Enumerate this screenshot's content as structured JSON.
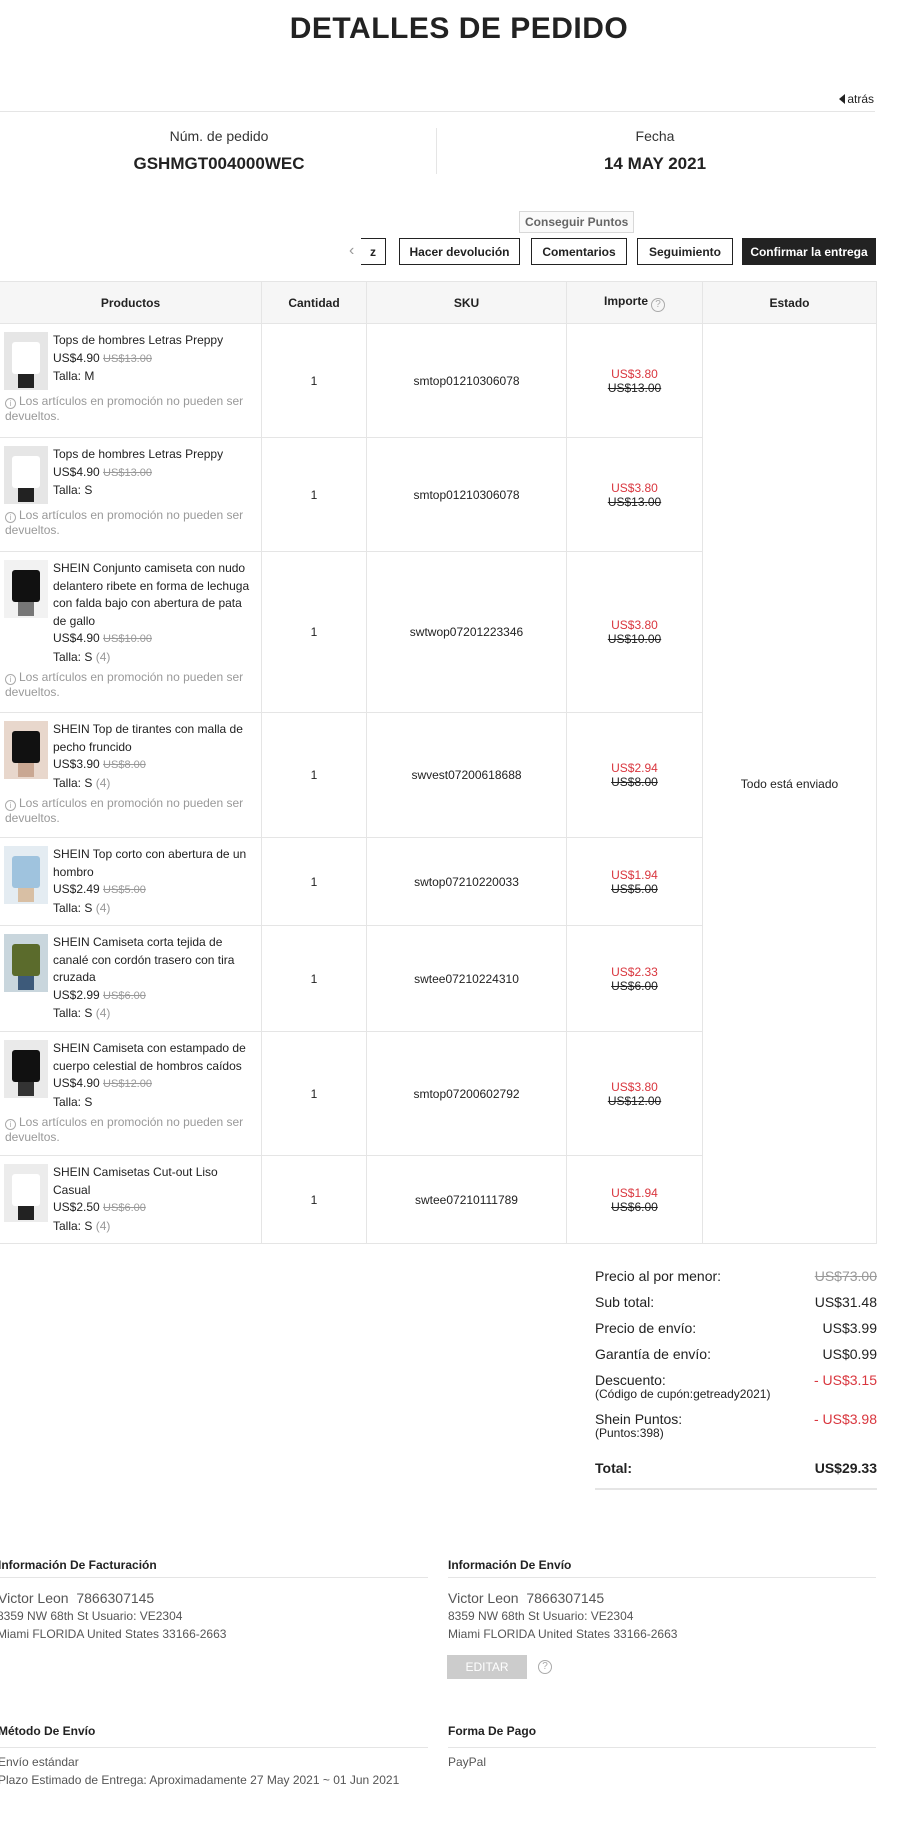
{
  "page": {
    "title": "DETALLES DE PEDIDO",
    "back_label": "atrás"
  },
  "order": {
    "number_label": "Núm. de pedido",
    "number": "GSHMGT004000WEC",
    "date_label": "Fecha",
    "date": "14 MAY 2021"
  },
  "tooltip": "Conseguir Puntos",
  "actions": {
    "partial": "z",
    "return": "Hacer devolución",
    "reviews": "Comentarios",
    "track": "Seguimiento",
    "confirm": "Confirmar la entrega"
  },
  "table": {
    "headers": {
      "products": "Productos",
      "qty": "Cantidad",
      "sku": "SKU",
      "amount": "Importe",
      "status": "Estado"
    },
    "status_text": "Todo está enviado",
    "promo_note": "Los artículos en promoción no pueden ser devueltos.",
    "rows": [
      {
        "name": "Tops de hombres Letras Preppy",
        "price": "US$4.90",
        "orig": "US$13.00",
        "size": "Talla: M",
        "size_qty": "",
        "qty": "1",
        "sku": "smtop01210306078",
        "amount": "US$3.80",
        "amount_orig": "US$13.00",
        "note": true
      },
      {
        "name": "Tops de hombres Letras Preppy",
        "price": "US$4.90",
        "orig": "US$13.00",
        "size": "Talla: S",
        "size_qty": "",
        "qty": "1",
        "sku": "smtop01210306078",
        "amount": "US$3.80",
        "amount_orig": "US$13.00",
        "note": true
      },
      {
        "name": "SHEIN Conjunto camiseta con nudo delantero ribete en forma de lechuga con falda bajo con abertura de pata de gallo",
        "price": "US$4.90",
        "orig": "US$10.00",
        "size": "Talla: S",
        "size_qty": "(4)",
        "qty": "1",
        "sku": "swtwop07201223346",
        "amount": "US$3.80",
        "amount_orig": "US$10.00",
        "note": true
      },
      {
        "name": "SHEIN Top de tirantes con malla de pecho fruncido",
        "price": "US$3.90",
        "orig": "US$8.00",
        "size": "Talla: S",
        "size_qty": "(4)",
        "qty": "1",
        "sku": "swvest07200618688",
        "amount": "US$2.94",
        "amount_orig": "US$8.00",
        "note": true
      },
      {
        "name": "SHEIN Top corto con abertura de un hombro",
        "price": "US$2.49",
        "orig": "US$5.00",
        "size": "Talla: S",
        "size_qty": "(4)",
        "qty": "1",
        "sku": "swtop07210220033",
        "amount": "US$1.94",
        "amount_orig": "US$5.00",
        "note": false
      },
      {
        "name": "SHEIN Camiseta corta tejida de canalé con cordón trasero con tira cruzada",
        "price": "US$2.99",
        "orig": "US$6.00",
        "size": "Talla: S",
        "size_qty": "(4)",
        "qty": "1",
        "sku": "swtee07210224310",
        "amount": "US$2.33",
        "amount_orig": "US$6.00",
        "note": false
      },
      {
        "name": "SHEIN Camiseta con estampado de cuerpo celestial de hombros caídos",
        "price": "US$4.90",
        "orig": "US$12.00",
        "size": "Talla: S",
        "size_qty": "",
        "qty": "1",
        "sku": "smtop07200602792",
        "amount": "US$3.80",
        "amount_orig": "US$12.00",
        "note": true
      },
      {
        "name": "SHEIN Camisetas Cut-out Liso Casual",
        "price": "US$2.50",
        "orig": "US$6.00",
        "size": "Talla: S",
        "size_qty": "(4)",
        "qty": "1",
        "sku": "swtee07210111789",
        "amount": "US$1.94",
        "amount_orig": "US$6.00",
        "note": false
      }
    ]
  },
  "summary": {
    "retail_label": "Precio al por menor:",
    "retail": "US$73.00",
    "subtotal_label": "Sub total:",
    "subtotal": "US$31.48",
    "shipping_label": "Precio de envío:",
    "shipping": "US$3.99",
    "guarantee_label": "Garantía de envío:",
    "guarantee": "US$0.99",
    "discount_label": "Descuento:",
    "discount_sub": "(Código de cupón:getready2021)",
    "discount": "- US$3.15",
    "points_label": "Shein Puntos:",
    "points_sub": "(Puntos:398)",
    "points": "- US$3.98",
    "total_label": "Total:",
    "total": "US$29.33"
  },
  "billing": {
    "title": "Información De Facturación",
    "name": "Victor Leon",
    "phone": "7866307145",
    "line1": "8359 NW 68th St Usuario: VE2304",
    "line2": "Miami FLORIDA United States 33166-2663"
  },
  "shipping_info": {
    "title": "Información De Envío",
    "name": "Victor Leon",
    "phone": "7866307145",
    "line1": "8359 NW 68th St Usuario: VE2304",
    "line2": "Miami FLORIDA United States 33166-2663",
    "edit_label": "EDITAR"
  },
  "ship_method": {
    "title": "Método De Envío",
    "method": "Envío estándar",
    "eta": "Plazo Estimado de Entrega: Aproximadamente 27 May 2021 ~ 01 Jun 2021"
  },
  "payment": {
    "title": "Forma De Pago",
    "method": "PayPal"
  },
  "colors": {
    "accent_red": "#d9363e",
    "dark_button": "#222222"
  }
}
